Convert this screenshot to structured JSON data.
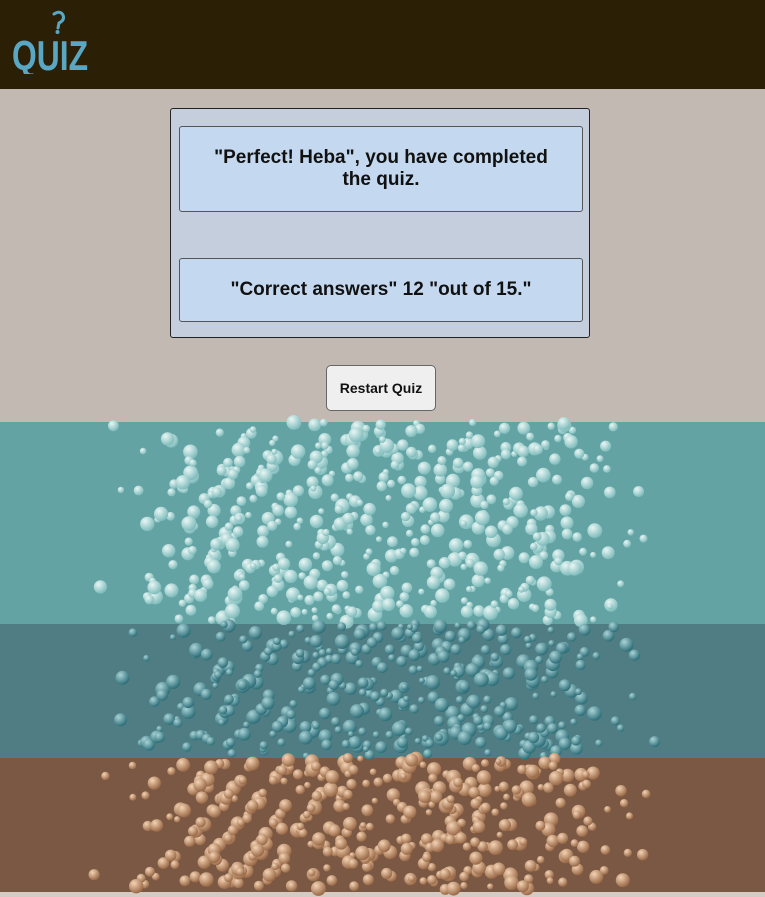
{
  "header": {
    "logo_text": "QUIZ",
    "logo_icon": "question-mark-icon"
  },
  "result": {
    "message": "\"Perfect! Heba\", you have completed the quiz.",
    "score": "\"Correct answers\" 12 \"out of 15.\""
  },
  "actions": {
    "restart_label": "Restart Quiz"
  },
  "colors": {
    "header_bg": "#2b1f06",
    "page_bg": "#c2b9b2",
    "card_bg": "#c4d9f0",
    "logo_color": "#5aa7c4",
    "teal_light": "#64a3a4",
    "teal_dark": "#4f7d83",
    "brown": "#7a5843"
  }
}
